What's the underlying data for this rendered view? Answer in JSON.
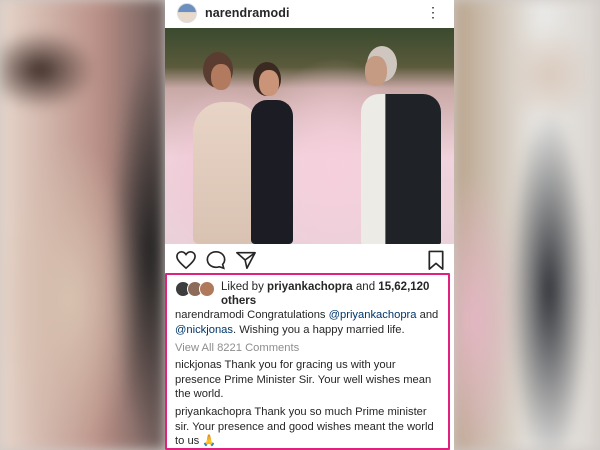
{
  "post": {
    "username": "narendramodi",
    "more_icon": "⋮",
    "liked_by_prefix": "Liked by",
    "liked_by_user": "priyankachopra",
    "and": "and",
    "likes_count": "15,62,120",
    "others": "others",
    "caption": {
      "user": "narendramodi",
      "text1": "Congratulations",
      "mention1": "@priyankachopra",
      "and": "and",
      "mention2": "@nickjonas",
      "text2": ". Wishing you a happy married life."
    },
    "view_all_comments": "View All 8221 Comments",
    "comments": [
      {
        "user": "nickjonas",
        "text": "Thank you for gracing us with your presence Prime Minister Sir. Your well wishes mean the world."
      },
      {
        "user": "priyankachopra",
        "text": "Thank you so much Prime minister sir. Your presence and good wishes meant the world to us 🙏"
      }
    ]
  },
  "icons": {
    "heart": "heart-icon",
    "comment": "comment-icon",
    "share": "share-icon",
    "save": "bookmark-icon"
  },
  "colors": {
    "highlight_border": "#e0227e",
    "text": "#262626",
    "muted": "#8e8e8e",
    "mention": "#003569"
  }
}
